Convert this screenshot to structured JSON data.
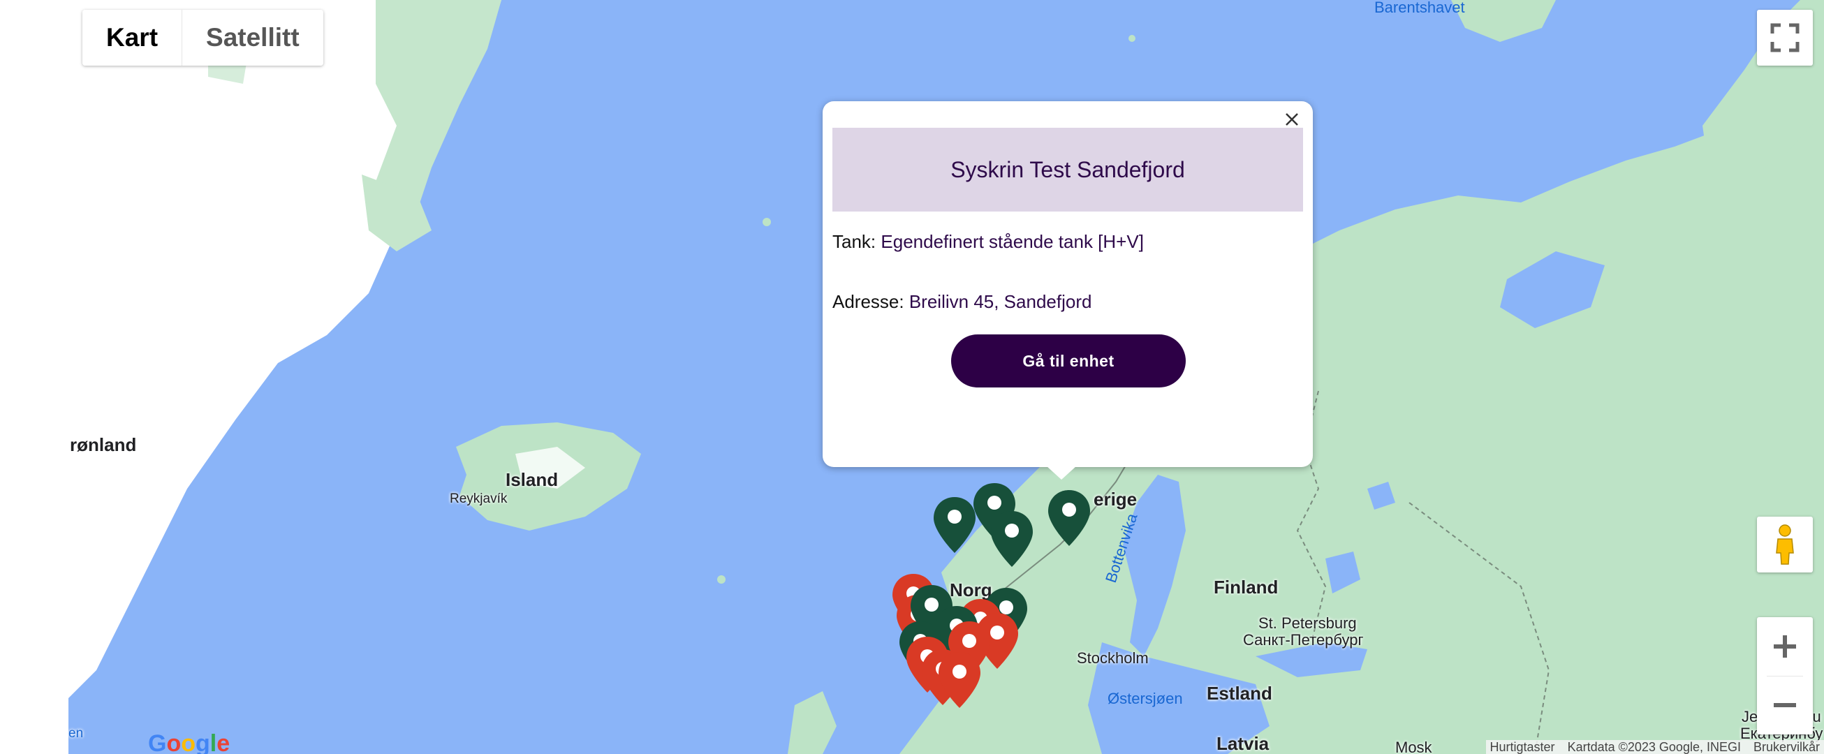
{
  "map_type": {
    "map_label": "Kart",
    "satellite_label": "Satellitt"
  },
  "popup": {
    "title": "Syskrin Test Sandefjord",
    "tank_label": "Tank:",
    "tank_value": "Egendefinert stående tank [H+V]",
    "address_label": "Adresse:",
    "address_value": "Breilivn 45, Sandefjord",
    "button_label": "Gå til enhet"
  },
  "labels": {
    "barents": "Barentshavet",
    "gronland": "rønland",
    "island": "Island",
    "reykjavik": "Reykjavík",
    "sverige": "erige",
    "norge": "Norg",
    "bottenvika": "Bottenvika",
    "finland": "Finland",
    "st_petersburg": "St. Petersburg",
    "st_petersburg_ru": "Санкт-Петербург",
    "stockholm": "Stockholm",
    "ostersjoen": "Østersjøen",
    "estland": "Estland",
    "latvia": "Latvia",
    "moskva": "Mosk",
    "jekaterinburg": "Jekaterinbu",
    "jekaterinburg_ru": "Екатеринбу",
    "left_edge": "en"
  },
  "attribution": {
    "shortcuts": "Hurtigtaster",
    "map_data": "Kartdata ©2023 Google, INEGI",
    "terms": "Brukervilkår"
  },
  "google_logo": "Google",
  "colors": {
    "water": "#8ab4f8",
    "land": "#bde3c6",
    "marker_green": "#17503a",
    "marker_red": "#d93a25",
    "popup_header": "#ded5e6",
    "button": "#2d0046"
  }
}
